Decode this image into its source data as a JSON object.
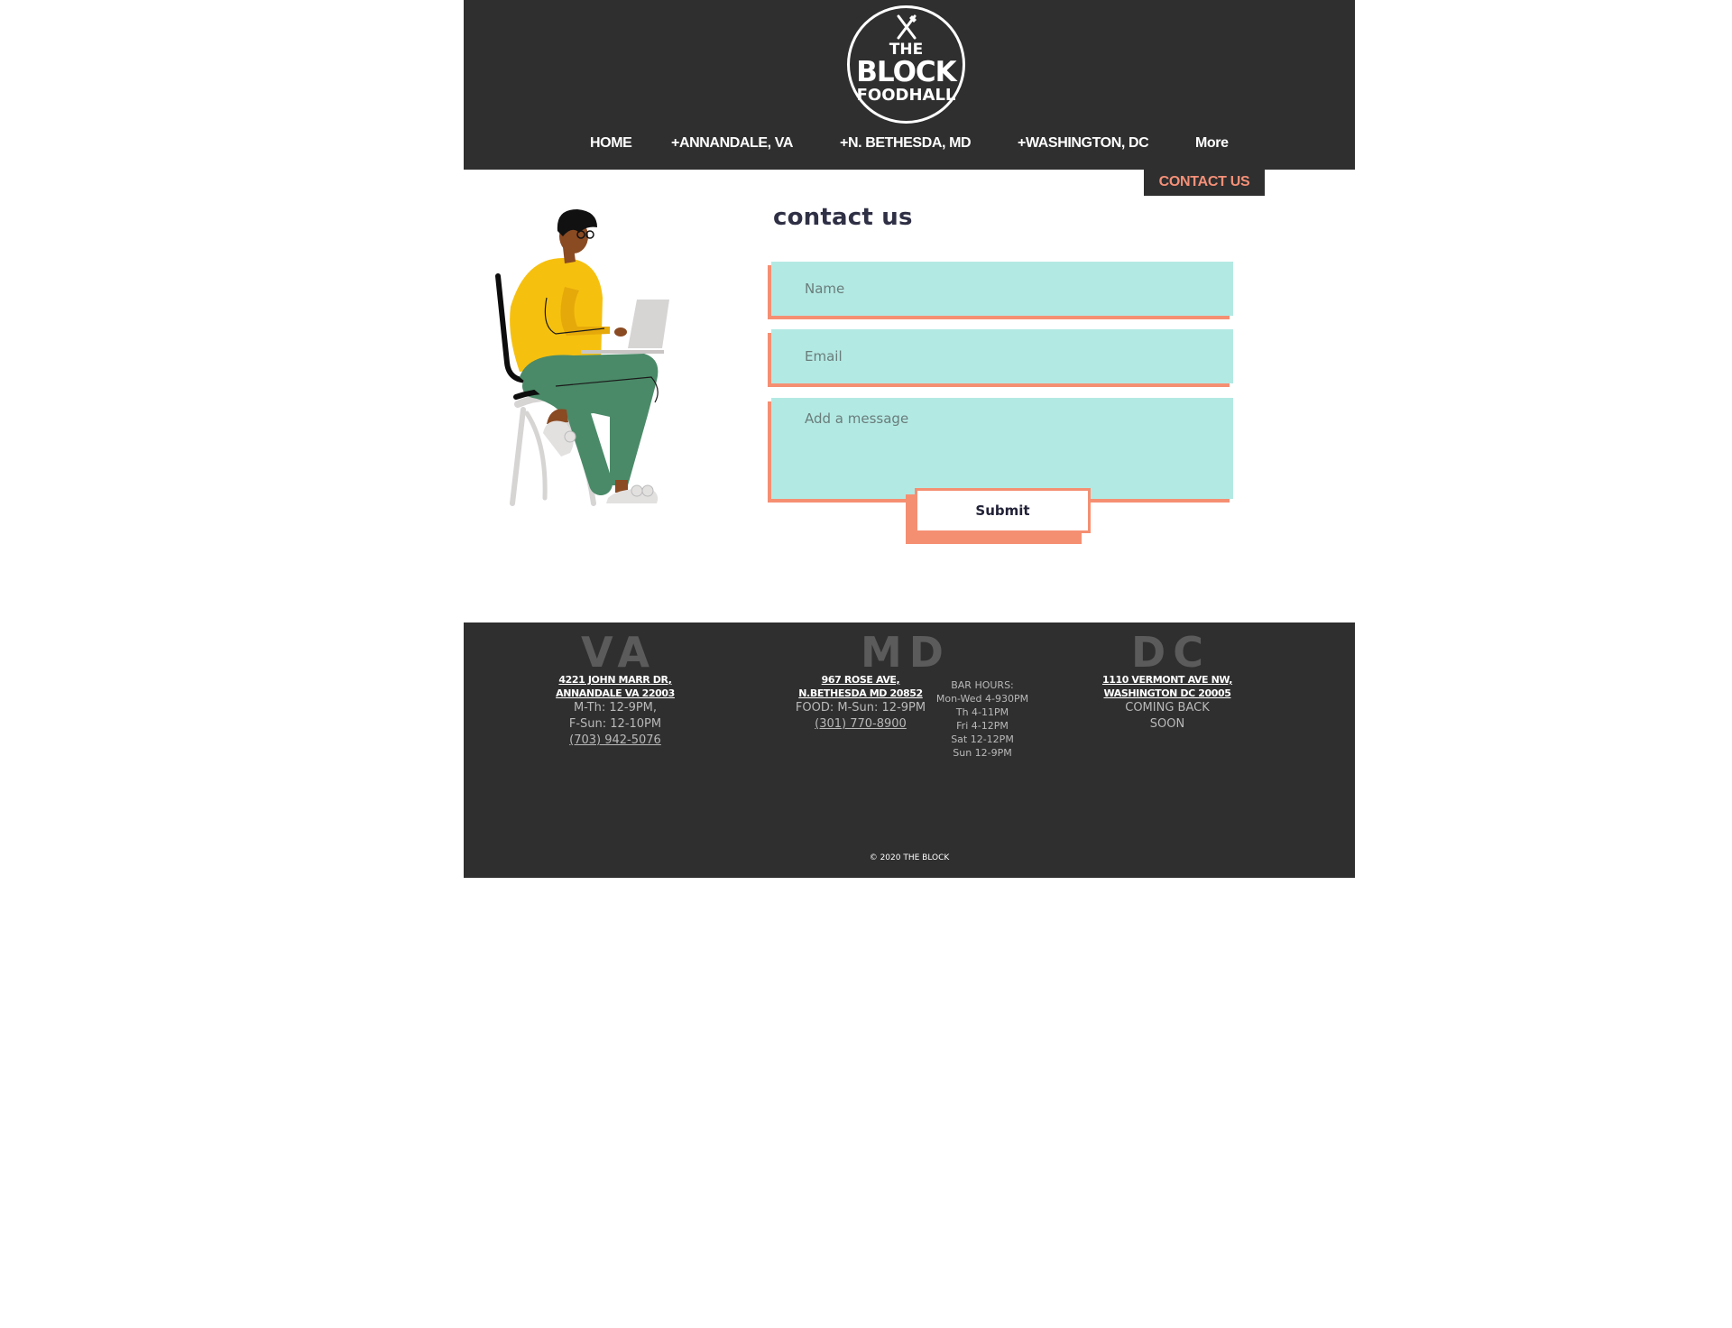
{
  "header": {
    "logo": {
      "line1": "THE",
      "line2": "BLOCK",
      "line3": "FOODHALL"
    },
    "nav": [
      {
        "label": "HOME"
      },
      {
        "label": "+ANNANDALE, VA"
      },
      {
        "label": "+N. BETHESDA, MD"
      },
      {
        "label": "+WASHINGTON, DC"
      },
      {
        "label": "More"
      }
    ],
    "more_menu": {
      "contact_label": "CONTACT US"
    }
  },
  "main": {
    "title": "contact us",
    "form": {
      "name_placeholder": "Name",
      "email_placeholder": "Email",
      "message_placeholder": "Add a message",
      "submit_label": "Submit"
    }
  },
  "footer": {
    "locations": [
      {
        "state": "VA",
        "address_line1": "4221 JOHN MARR DR,",
        "address_line2": "ANNANDALE VA 22003",
        "hours_line1": "M-Th: 12-9PM,",
        "hours_line2": "F-Sun: 12-10PM",
        "phone": "(703) 942-5076"
      },
      {
        "state": "MD",
        "address_line1": "967 ROSE AVE,",
        "address_line2": "N.BETHESDA MD 20852",
        "hours_line1": "FOOD: M-Sun: 12-9PM",
        "phone": "(301) 770-8900",
        "bar_hours": [
          "BAR HOURS:",
          "Mon-Wed 4-930PM",
          "Th 4-11PM",
          "Fri 4-12PM",
          "Sat 12-12PM",
          "Sun 12-9PM"
        ]
      },
      {
        "state": "DC",
        "address_line1": "1110 VERMONT AVE  NW,",
        "address_line2": "WASHINGTON DC 20005",
        "status_line1": "COMING BACK",
        "status_line2": "SOON"
      }
    ],
    "copyright": "© 2020 THE BLOCK"
  },
  "colors": {
    "header_bg": "#2f2f2f",
    "accent_coral": "#f58f72",
    "field_bg": "#b3e9e3",
    "illustration_sweater": "#f6c00f",
    "illustration_pants": "#4a8a68"
  }
}
